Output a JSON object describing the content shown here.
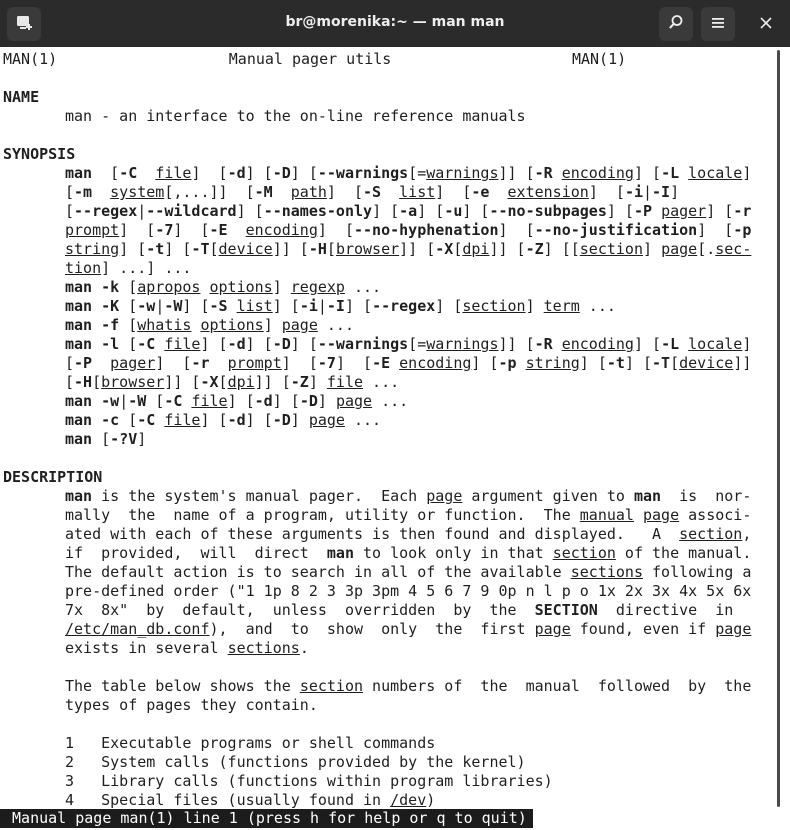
{
  "window": {
    "title": "br@morenika:~ — man man",
    "new_tab_icon": "new-tab-icon",
    "search_icon": "search-icon",
    "menu_icon": "hamburger-menu-icon",
    "close_icon": "close-icon"
  },
  "man": {
    "header_left": "MAN(1)",
    "header_center": "Manual pager utils",
    "header_right": "MAN(1)",
    "s_name": "NAME",
    "name_line": "man - an interface to the on-line reference manuals",
    "s_synopsis": "SYNOPSIS",
    "s_description": "DESCRIPTION",
    "desc_p2_line1": "The table below shows the section numbers of the manual followed by the",
    "desc_p2_line2": "types of pages they contain.",
    "sections_table": [
      {
        "num": "1",
        "text": "Executable programs or shell commands"
      },
      {
        "num": "2",
        "text": "System calls (functions provided by the kernel)"
      },
      {
        "num": "3",
        "text": "Library calls (functions within program libraries)"
      },
      {
        "num": "4",
        "text": "Special files (usually found in /dev)"
      }
    ]
  },
  "status": {
    "text": " Manual page man(1) line 1 (press h for help or q to quit)"
  }
}
